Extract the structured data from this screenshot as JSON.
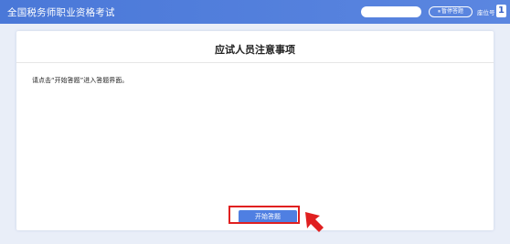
{
  "header": {
    "title": "全国税务师职业资格考试",
    "pause_label": "暂停答题",
    "pause_icon": "pause-icon",
    "seat_label": "座位号",
    "seat_number": "1"
  },
  "notice": {
    "title": "应试人员注意事项",
    "instruction": "请点击“开始答题”进入答题界面。"
  },
  "actions": {
    "start_label": "开始答题"
  },
  "colors": {
    "header": "#4a78d8",
    "background": "#e9eef8",
    "button": "#4f7fe2",
    "annotation": "#e02020"
  }
}
